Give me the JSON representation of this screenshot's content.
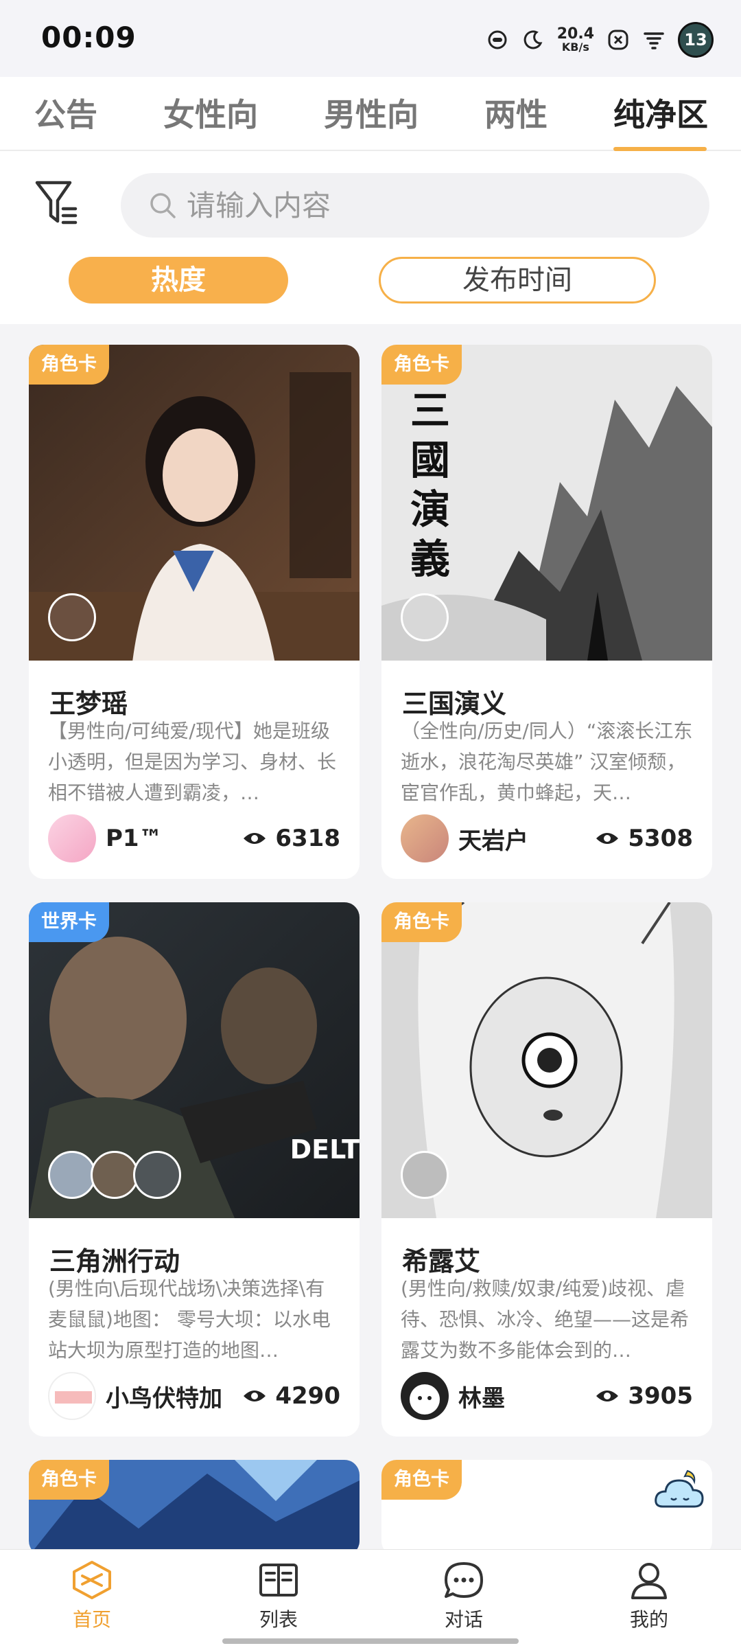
{
  "status_bar": {
    "time": "00:09",
    "net_speed_value": "20.4",
    "net_speed_unit": "KB/s",
    "battery": "13",
    "icons": [
      "game-icon",
      "moon-icon",
      "net-speed",
      "close-box-icon",
      "wifi-icon",
      "battery-badge"
    ]
  },
  "tabs": [
    {
      "label": "公告",
      "active": false
    },
    {
      "label": "女性向",
      "active": false
    },
    {
      "label": "男性向",
      "active": false
    },
    {
      "label": "两性",
      "active": false
    },
    {
      "label": "纯净区",
      "active": true
    }
  ],
  "search": {
    "placeholder": "请输入内容",
    "value": ""
  },
  "sort": {
    "hot_label": "热度",
    "time_label": "发布时间",
    "selected": "热度"
  },
  "cards": [
    {
      "badge": "角色卡",
      "title": "王梦瑶",
      "desc": "【男性向/可纯爱/现代】她是班级小透明，但是因为学习、身材、长相不错被人遭到霸凌，…",
      "author": "P1™",
      "views": "6318"
    },
    {
      "badge": "角色卡",
      "title": "三国演义",
      "desc": "（全性向/历史/同人）“滚滚长江东逝水，浪花淘尽英雄” 汉室倾颓，宦官作乱，黄巾蜂起，天…",
      "author": "天岩户",
      "views": "5308",
      "image_calligraphy": "三國演義"
    },
    {
      "badge": "世界卡",
      "title": "三角洲行动",
      "desc": "(男性向\\后现代战场\\决策选择\\有麦鼠鼠)地图： 零号大坝：以水电站大坝为原型打造的地图…",
      "author": "小鸟伏特加",
      "views": "4290",
      "image_text": "DELT"
    },
    {
      "badge": "角色卡",
      "title": "希露艾",
      "desc": "(男性向/救赎/奴隶/纯爱)歧视、虐待、恐惧、冰冷、绝望——这是希露艾为数不多能体会到的…",
      "author": "林墨",
      "views": "3905"
    },
    {
      "badge": "角色卡"
    },
    {
      "badge": "角色卡"
    }
  ],
  "bottom_nav": [
    {
      "label": "首页",
      "icon": "home-icon",
      "active": true
    },
    {
      "label": "列表",
      "icon": "book-icon",
      "active": false
    },
    {
      "label": "对话",
      "icon": "chat-icon",
      "active": false
    },
    {
      "label": "我的",
      "icon": "user-icon",
      "active": false
    }
  ],
  "colors": {
    "accent": "#f6b048",
    "world_badge": "#4a98f0",
    "active_nav": "#f0a030"
  }
}
